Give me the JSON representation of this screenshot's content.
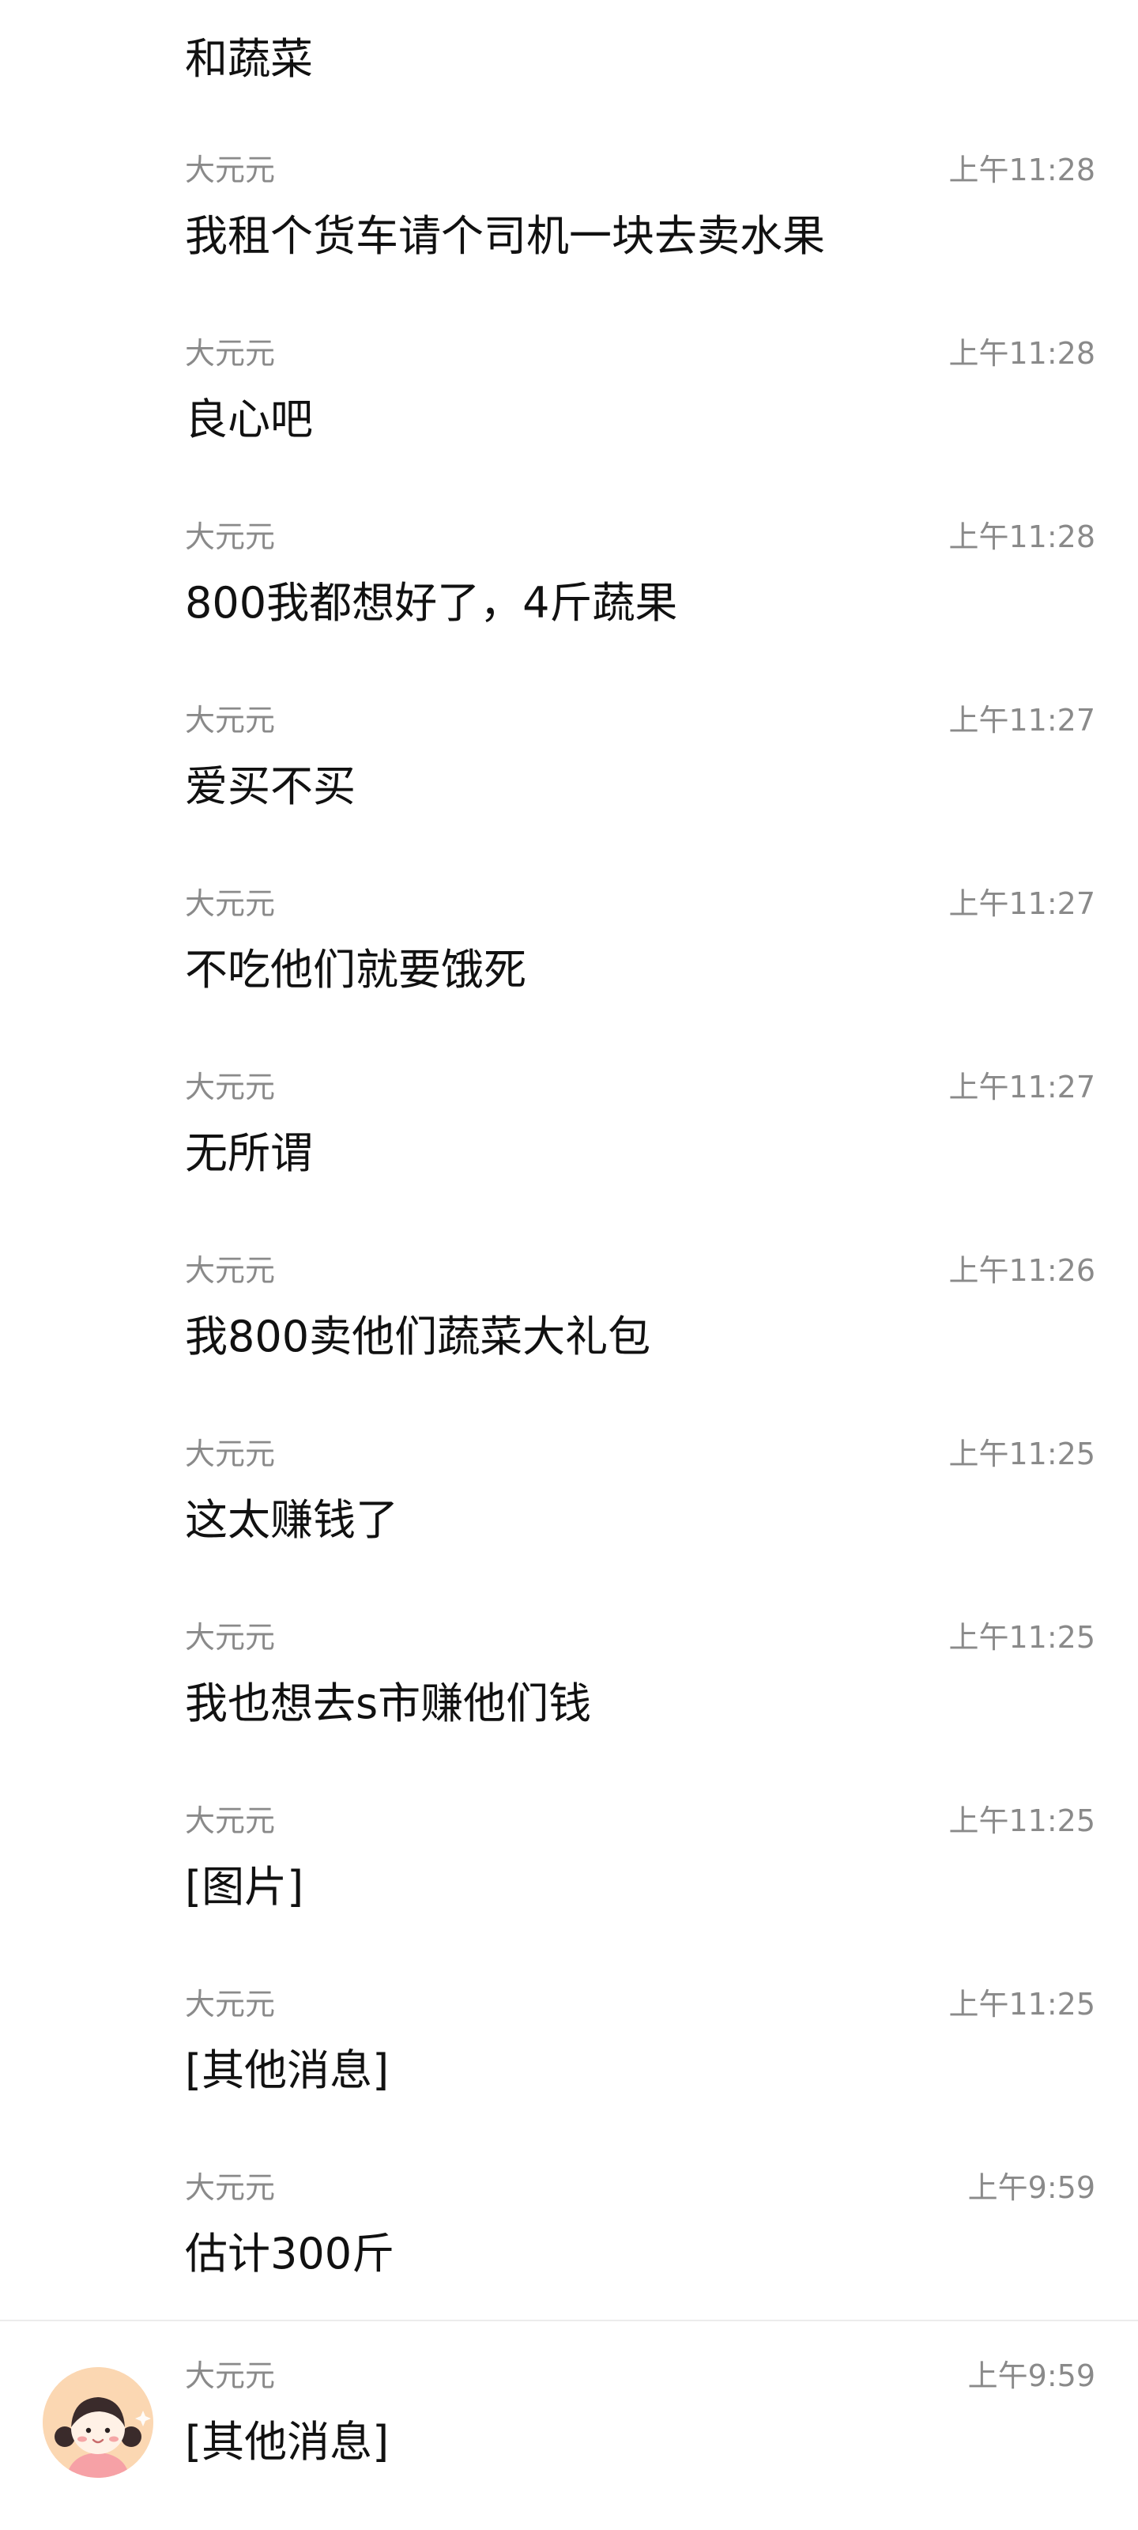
{
  "top_text": "和蔬菜",
  "messages": [
    {
      "sender": "大元元",
      "time": "上午11:28",
      "text": "我租个货车请个司机一块去卖水果"
    },
    {
      "sender": "大元元",
      "time": "上午11:28",
      "text": "良心吧"
    },
    {
      "sender": "大元元",
      "time": "上午11:28",
      "text": "800我都想好了，4斤蔬果"
    },
    {
      "sender": "大元元",
      "time": "上午11:27",
      "text": "爱买不买"
    },
    {
      "sender": "大元元",
      "time": "上午11:27",
      "text": "不吃他们就要饿死"
    },
    {
      "sender": "大元元",
      "time": "上午11:27",
      "text": "无所谓"
    },
    {
      "sender": "大元元",
      "time": "上午11:26",
      "text": "我800卖他们蔬菜大礼包"
    },
    {
      "sender": "大元元",
      "time": "上午11:25",
      "text": "这太赚钱了"
    },
    {
      "sender": "大元元",
      "time": "上午11:25",
      "text": "我也想去s市赚他们钱"
    },
    {
      "sender": "大元元",
      "time": "上午11:25",
      "text": "[图片]"
    },
    {
      "sender": "大元元",
      "time": "上午11:25",
      "text": "[其他消息]"
    },
    {
      "sender": "大元元",
      "time": "上午9:59",
      "text": "估计300斤"
    },
    {
      "sender": "大元元",
      "time": "上午9:59",
      "text": "[其他消息]"
    }
  ],
  "avatar": {
    "icon": "girl-avatar-icon",
    "bg_color": "#fbd7b2"
  }
}
